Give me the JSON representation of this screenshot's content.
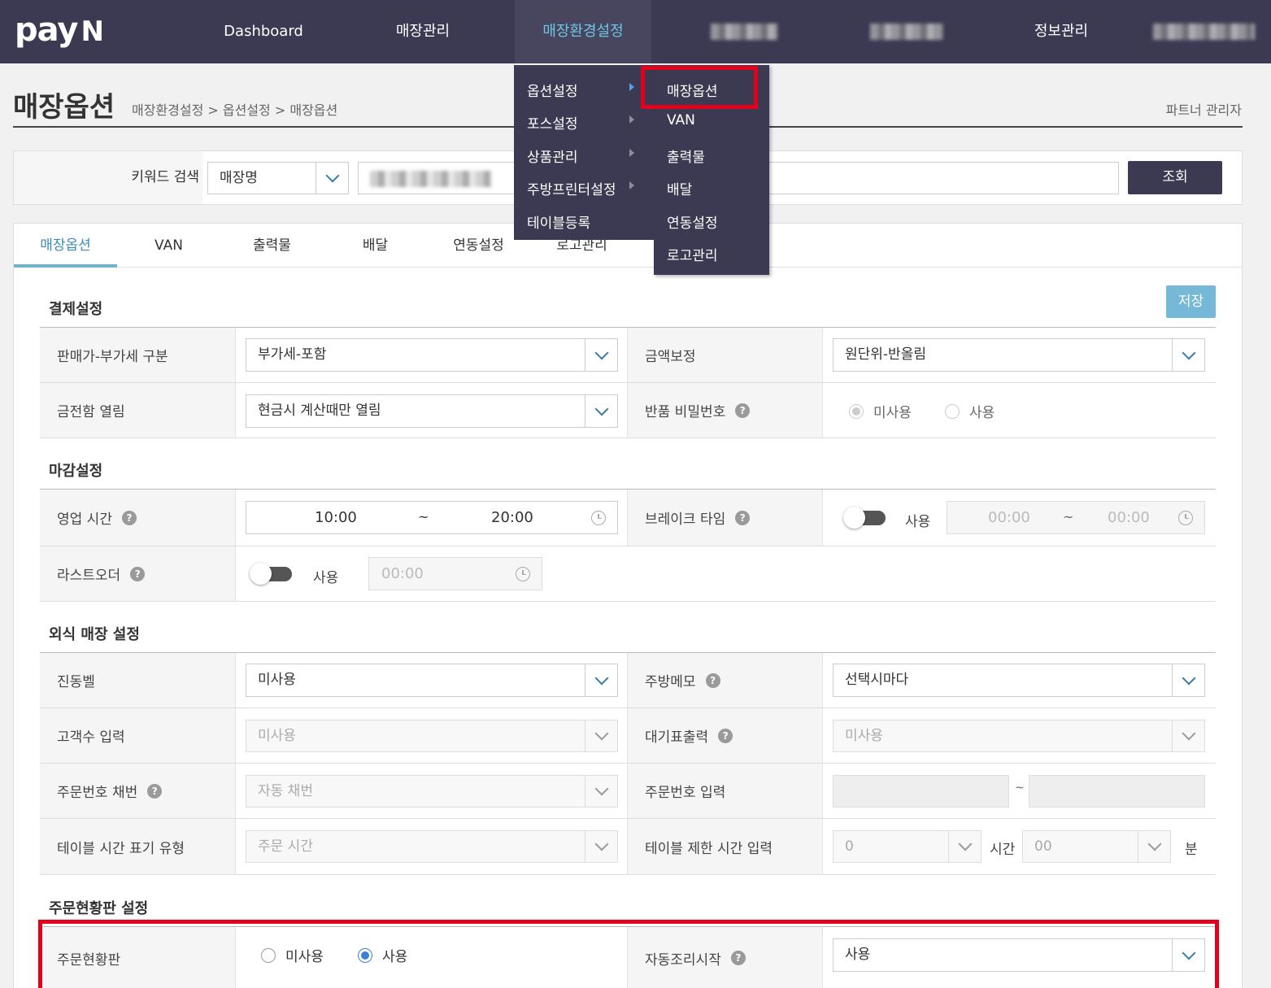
{
  "brand": {
    "logo": "pay",
    "logo_n": "N"
  },
  "nav": {
    "items": [
      "Dashboard",
      "매장관리",
      "매장환경설정",
      "정보관리"
    ],
    "active": "매장환경설정"
  },
  "page": {
    "title": "매장옵션",
    "breadcrumb": "매장환경설정 > 옵션설정 > 매장옵션",
    "admin_label": "파트너 관리자"
  },
  "search": {
    "label": "키워드 검색",
    "field_select": "매장명",
    "button": "조회"
  },
  "tabs": [
    "매장옵션",
    "VAN",
    "출력물",
    "배달",
    "연동설정",
    "로고관리"
  ],
  "save_button": "저장",
  "menu": {
    "level1": [
      "옵션설정",
      "포스설정",
      "상품관리",
      "주방프린터설정",
      "테이블등록"
    ],
    "level2": [
      "매장옵션",
      "VAN",
      "출력물",
      "배달",
      "연동설정",
      "로고관리"
    ]
  },
  "sections": {
    "payment": {
      "title": "결제설정",
      "vat_label": "판매가-부가세 구분",
      "vat_value": "부가세-포함",
      "rounding_label": "금액보정",
      "rounding_value": "원단위-반올림",
      "drawer_label": "금전함 열림",
      "drawer_value": "현금시 계산때만 열림",
      "refund_pw_label": "반품 비밀번호",
      "refund_pw_options": [
        "미사용",
        "사용"
      ],
      "refund_pw_selected": "미사용"
    },
    "closing": {
      "title": "마감설정",
      "hours_label": "영업 시간",
      "hours_start": "10:00",
      "hours_sep": "~",
      "hours_end": "20:00",
      "break_label": "브레이크 타임",
      "break_toggle_label": "사용",
      "break_start": "00:00",
      "break_sep": "~",
      "break_end": "00:00",
      "lastorder_label": "라스트오더",
      "lastorder_toggle_label": "사용",
      "lastorder_time": "00:00"
    },
    "dining": {
      "title": "외식 매장 설정",
      "buzzer_label": "진동벨",
      "buzzer_value": "미사용",
      "kitchen_memo_label": "주방메모",
      "kitchen_memo_value": "선택시마다",
      "guest_label": "고객수 입력",
      "guest_value": "미사용",
      "ticket_label": "대기표출력",
      "ticket_value": "미사용",
      "order_no_label": "주문번호 채번",
      "order_no_value": "자동 채번",
      "order_no_input_label": "주문번호 입력",
      "order_no_sep": "~",
      "table_time_label": "테이블 시간 표기 유형",
      "table_time_value": "주문 시간",
      "table_limit_label": "테이블 제한 시간 입력",
      "table_limit_hours": "0",
      "table_limit_hours_unit": "시간",
      "table_limit_minutes": "00",
      "table_limit_minutes_unit": "분"
    },
    "order_board": {
      "title": "주문현황판 설정",
      "board_label": "주문현황판",
      "board_options": [
        "미사용",
        "사용"
      ],
      "board_selected": "사용",
      "auto_cook_label": "자동조리시작",
      "auto_cook_value": "사용"
    }
  },
  "colors": {
    "nav_bg": "#3c3a52",
    "accent": "#6ec6e6",
    "highlight": "#e3001b",
    "save": "#75b8d8"
  }
}
